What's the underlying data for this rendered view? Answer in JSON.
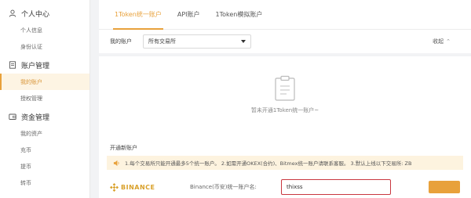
{
  "sidebar": {
    "groups": [
      {
        "icon": "user-icon",
        "title": "个人中心",
        "items": [
          "个人信息",
          "身份认证"
        ]
      },
      {
        "icon": "document-icon",
        "title": "账户管理",
        "items": [
          "我的账户",
          "授权管理"
        ]
      },
      {
        "icon": "wallet-icon",
        "title": "资金管理",
        "items": [
          "我的资产",
          "充币",
          "提币",
          "转币"
        ]
      }
    ],
    "active_item": "我的账户"
  },
  "tabs": [
    "1Token统一账户",
    "API账户",
    "1Token模拟账户"
  ],
  "active_tab": "1Token统一账户",
  "filter": {
    "label": "我的账户",
    "select_value": "所有交易所",
    "collapse_label": "收起"
  },
  "empty_state": {
    "icon": "clipboard-icon",
    "text": "暂未开通1Token统一账户~"
  },
  "open_section": {
    "title": "开通新账户",
    "notice": "1.每个交易所只能开通最多5个统一账户。 2.如需开通OKEX(合约)、Bitmex统一账户请联系客服。 3.默认上线以下交易所: ZB"
  },
  "exchange_row": {
    "logo_text": "BINANCE",
    "label": "Binance(币安)统一账户名:",
    "input_value": "thixss"
  },
  "colors": {
    "accent": "#e8a13b",
    "binance_gold": "#d9a12b",
    "input_border": "#c9373f",
    "notice_bg": "#fdf3df"
  }
}
